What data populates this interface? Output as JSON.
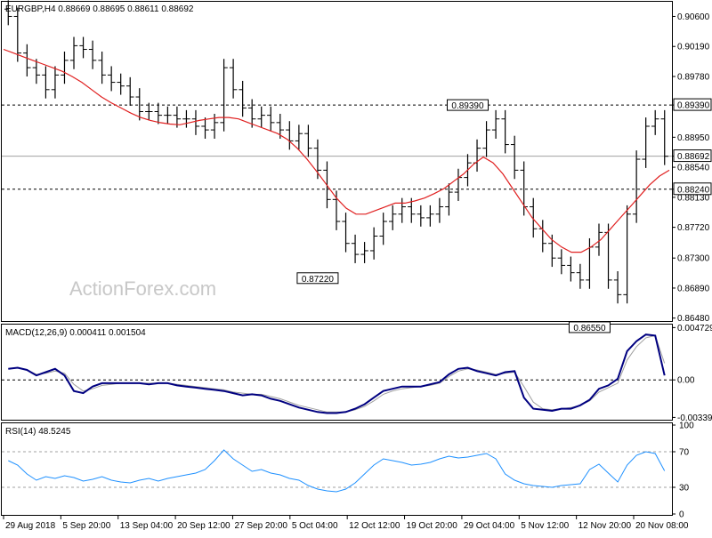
{
  "chart_data": [
    {
      "type": "bar",
      "panel": "price",
      "title": "EURGBP,H4  0.88669 0.88695 0.88611 0.88692",
      "watermark": "ActionForex.com",
      "ylim": [
        0.8644,
        0.908
      ],
      "y_ticks": [
        "0.90600",
        "0.90190",
        "0.89780",
        "0.89390",
        "0.88950",
        "0.88692",
        "0.88540",
        "0.88240",
        "0.88130",
        "0.87720",
        "0.87300",
        "0.86890",
        "0.86480"
      ],
      "highlight_labels": [
        "0.89390",
        "0.88692",
        "0.88240"
      ],
      "horizontal_levels": [
        {
          "value": 0.8939,
          "style": "dashed"
        },
        {
          "value": 0.8824,
          "style": "dashed"
        },
        {
          "value": 0.88692,
          "style": "solid-gray"
        }
      ],
      "annotations": [
        {
          "text": "0.89390",
          "x": 49,
          "y": 0.8939
        },
        {
          "text": "0.87220",
          "x": 33,
          "y": 0.8722
        },
        {
          "text": "0.86550",
          "x": 62,
          "y": 0.8655
        }
      ],
      "colors": {
        "bars": "#000000",
        "ma": "#e02020",
        "highlight_box": "#000000"
      },
      "bar_count": 71,
      "close": [
        0.906,
        0.901,
        0.899,
        0.898,
        0.896,
        0.898,
        0.9,
        0.902,
        0.9015,
        0.9,
        0.898,
        0.897,
        0.8965,
        0.895,
        0.893,
        0.893,
        0.8925,
        0.8925,
        0.892,
        0.892,
        0.891,
        0.8905,
        0.8915,
        0.899,
        0.896,
        0.8935,
        0.892,
        0.8925,
        0.8915,
        0.8905,
        0.889,
        0.89,
        0.888,
        0.885,
        0.881,
        0.878,
        0.875,
        0.8735,
        0.874,
        0.876,
        0.878,
        0.879,
        0.88,
        0.879,
        0.8785,
        0.879,
        0.88,
        0.882,
        0.884,
        0.886,
        0.888,
        0.8905,
        0.892,
        0.8885,
        0.885,
        0.88,
        0.877,
        0.875,
        0.873,
        0.872,
        0.871,
        0.87,
        0.8745,
        0.8765,
        0.87,
        0.868,
        0.879,
        0.8865,
        0.891,
        0.892,
        0.8869
      ],
      "ma": [
        0.9015,
        0.901,
        0.9005,
        0.9,
        0.8995,
        0.899,
        0.8985,
        0.8978,
        0.897,
        0.896,
        0.895,
        0.8942,
        0.8935,
        0.8928,
        0.8922,
        0.8918,
        0.8915,
        0.8913,
        0.8912,
        0.8915,
        0.8918,
        0.892,
        0.8922,
        0.8922,
        0.892,
        0.8915,
        0.891,
        0.8905,
        0.89,
        0.8892,
        0.888,
        0.8865,
        0.8848,
        0.883,
        0.8812,
        0.8798,
        0.879,
        0.879,
        0.8795,
        0.88,
        0.8805,
        0.8805,
        0.8808,
        0.8812,
        0.8818,
        0.8825,
        0.8835,
        0.8845,
        0.8858,
        0.8868,
        0.886,
        0.8845,
        0.8825,
        0.8805,
        0.8785,
        0.877,
        0.8755,
        0.8745,
        0.8738,
        0.8738,
        0.8745,
        0.8755,
        0.877,
        0.8785,
        0.88,
        0.8815,
        0.883,
        0.8842,
        0.885
      ]
    },
    {
      "type": "line",
      "panel": "macd",
      "title": "MACD(12,26,9) 0.000411 0.001504",
      "ylim": [
        -0.0036,
        0.005
      ],
      "y_ticks": [
        "0.004729",
        "0.00",
        "-0.003391"
      ],
      "zero_line": true,
      "series": [
        {
          "name": "MACD",
          "color": "#000080",
          "values": [
            0.001,
            0.0011,
            0.0009,
            0.0004,
            0.0007,
            0.001,
            0.0004,
            -0.001,
            -0.0012,
            -0.0006,
            -0.0003,
            -0.0003,
            -0.0003,
            -0.0003,
            -0.0003,
            -0.0004,
            -0.0003,
            -0.0003,
            -0.0005,
            -0.0006,
            -0.0007,
            -0.0008,
            -0.0009,
            -0.001,
            -0.0012,
            -0.0014,
            -0.0013,
            -0.0014,
            -0.0017,
            -0.0019,
            -0.0022,
            -0.0025,
            -0.0027,
            -0.0029,
            -0.003,
            -0.003,
            -0.0029,
            -0.0026,
            -0.0022,
            -0.0016,
            -0.001,
            -0.0008,
            -0.0006,
            -0.0006,
            -0.0006,
            -0.0004,
            -0.0002,
            0.0005,
            0.001,
            0.0011,
            0.0008,
            0.0006,
            0.0004,
            0.0007,
            0.0008,
            -0.0016,
            -0.0026,
            -0.0027,
            -0.0028,
            -0.0026,
            -0.0026,
            -0.0023,
            -0.0018,
            -0.0008,
            -0.0005,
            0.0001,
            0.0026,
            0.0035,
            0.0041,
            0.004,
            0.0004
          ]
        },
        {
          "name": "Signal",
          "color": "#a0a0a0",
          "values": [
            0.001,
            0.0011,
            0.0009,
            0.0005,
            0.0006,
            0.0008,
            0.0006,
            -0.0004,
            -0.001,
            -0.0008,
            -0.0005,
            -0.0004,
            -0.0003,
            -0.0003,
            -0.0003,
            -0.0003,
            -0.0003,
            -0.0003,
            -0.0004,
            -0.0005,
            -0.0006,
            -0.0007,
            -0.0008,
            -0.0009,
            -0.0011,
            -0.0012,
            -0.0013,
            -0.0013,
            -0.0015,
            -0.0017,
            -0.002,
            -0.0023,
            -0.0025,
            -0.0027,
            -0.0029,
            -0.0029,
            -0.0029,
            -0.0027,
            -0.0024,
            -0.0019,
            -0.0013,
            -0.001,
            -0.0008,
            -0.0007,
            -0.0006,
            -0.0005,
            -0.0003,
            0.0003,
            0.0008,
            0.001,
            0.0009,
            0.0007,
            0.0005,
            0.0006,
            0.0007,
            -0.0006,
            -0.002,
            -0.0026,
            -0.0027,
            -0.0026,
            -0.0025,
            -0.0023,
            -0.0019,
            -0.0011,
            -0.0007,
            -0.0003,
            0.0018,
            0.003,
            0.0038,
            0.004,
            0.0015
          ]
        }
      ]
    },
    {
      "type": "line",
      "panel": "rsi",
      "title": "RSI(14) 48.5245",
      "ylim": [
        0,
        100
      ],
      "y_ticks": [
        "100",
        "70",
        "30",
        "0"
      ],
      "levels": [
        70,
        30
      ],
      "series": [
        {
          "name": "RSI",
          "color": "#1e90ff",
          "values": [
            60,
            55,
            45,
            38,
            42,
            40,
            43,
            41,
            37,
            39,
            42,
            38,
            36,
            35,
            38,
            40,
            37,
            40,
            42,
            44,
            46,
            50,
            60,
            72,
            62,
            55,
            48,
            50,
            46,
            44,
            40,
            38,
            32,
            28,
            26,
            25,
            28,
            35,
            45,
            55,
            62,
            60,
            58,
            55,
            56,
            58,
            62,
            65,
            63,
            64,
            66,
            68,
            62,
            45,
            38,
            34,
            32,
            31,
            30,
            32,
            33,
            34,
            50,
            56,
            46,
            36,
            55,
            66,
            70,
            68,
            48.5
          ]
        }
      ]
    }
  ],
  "x_axis": {
    "labels": [
      "29 Aug 2018",
      "5 Sep 20:00",
      "13 Sep 04:00",
      "20 Sep 12:00",
      "27 Sep 20:00",
      "5 Oct 04:00",
      "12 Oct 12:00",
      "19 Oct 20:00",
      "29 Oct 04:00",
      "5 Nov 12:00",
      "12 Nov 20:00",
      "20 Nov 08:00"
    ]
  }
}
